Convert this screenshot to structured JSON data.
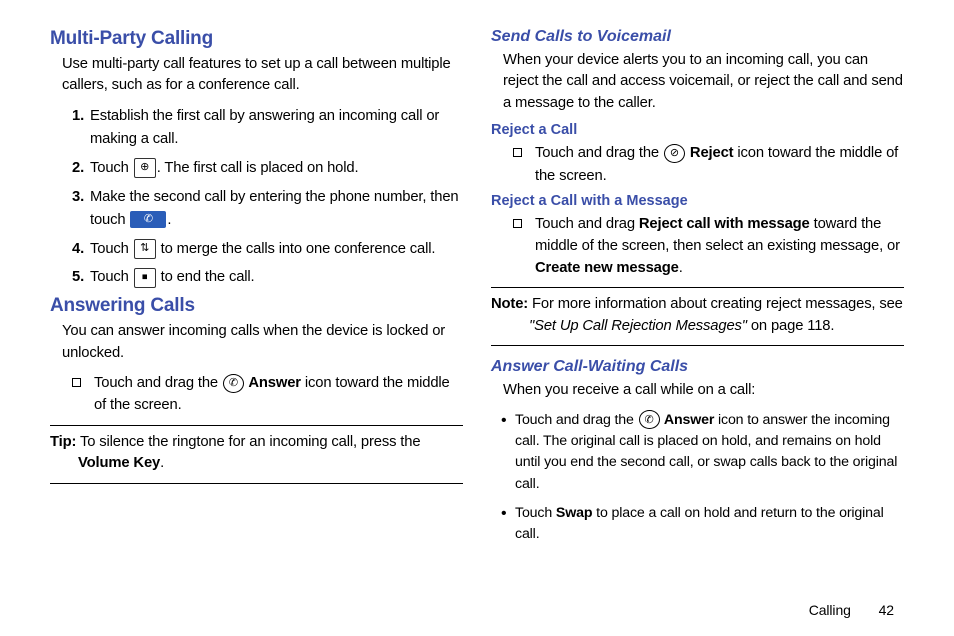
{
  "left": {
    "h1": "Multi-Party Calling",
    "p1": "Use multi-party call features to set up a call between multiple callers, such as for a conference call.",
    "steps": {
      "s1": "Establish the first call by answering an incoming call or making a call.",
      "s2a": "Touch ",
      "s2b": ". The first call is placed on hold.",
      "s3a": "Make the second call by entering the phone number, then touch ",
      "s3b": ".",
      "s4a": "Touch ",
      "s4b": " to merge the calls into one conference call.",
      "s5a": "Touch ",
      "s5b": " to end the call."
    },
    "h2": "Answering Calls",
    "p2": "You can answer incoming calls when the device is locked or unlocked.",
    "bul1a": "Touch and drag the ",
    "bul1b": " Answer",
    "bul1c": " icon toward the middle of the screen.",
    "tip_label": "Tip:",
    "tip_a": " To silence the ringtone for an incoming call, press the ",
    "tip_b": "Volume Key",
    "tip_c": "."
  },
  "right": {
    "h1": "Send Calls to Voicemail",
    "p1": "When your device alerts you to an incoming call, you can reject the call and access voicemail, or reject the call and send a message to the caller.",
    "h2": "Reject a Call",
    "bul1a": "Touch and drag the ",
    "bul1b": " Reject",
    "bul1c": " icon toward the middle of the screen.",
    "h3": "Reject a Call with a Message",
    "bul2a": "Touch and drag ",
    "bul2b": "Reject call with message",
    "bul2c": " toward the middle of the screen, then select an existing message, or ",
    "bul2d": "Create new message",
    "bul2e": ".",
    "note_label": "Note:",
    "note_a": " For more information about creating reject messages, see ",
    "note_b": "\"Set Up Call Rejection Messages\"",
    "note_c": " on page 118.",
    "h4": "Answer Call-Waiting Calls",
    "p2": "When you receive a call while on a call:",
    "d1a": "Touch and drag the ",
    "d1b": " Answer",
    "d1c": " icon to answer the incoming call. The original call is placed on hold, and remains on hold until you end the second call, or swap calls back to the original call.",
    "d2a": "Touch ",
    "d2b": "Swap",
    "d2c": " to place a call on hold and return to the original call."
  },
  "footer": {
    "section": "Calling",
    "page": "42"
  },
  "icons": {
    "addcall": "⊕",
    "call": "✆",
    "merge": "⇅",
    "end": "⏹",
    "answer": "✆",
    "reject": "⊘"
  }
}
